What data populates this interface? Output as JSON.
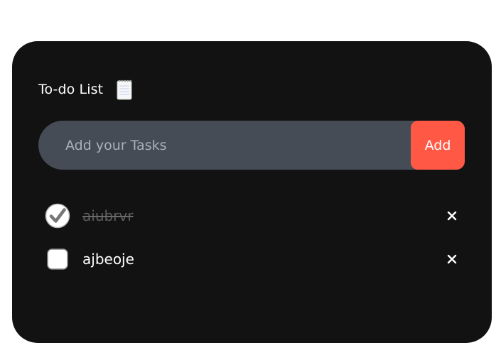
{
  "app": {
    "title": "To-do List",
    "title_icon": "notepad-icon"
  },
  "input": {
    "placeholder": "Add your Tasks",
    "value": "",
    "add_label": "Add"
  },
  "tasks": [
    {
      "text": "aiubrvr",
      "completed": true
    },
    {
      "text": "ajbeoje",
      "completed": false
    }
  ],
  "colors": {
    "card_bg": "#121212",
    "input_bg": "#454c56",
    "add_button": "#ff5945",
    "text": "#ffffff",
    "completed_text": "#5e5e5e"
  }
}
